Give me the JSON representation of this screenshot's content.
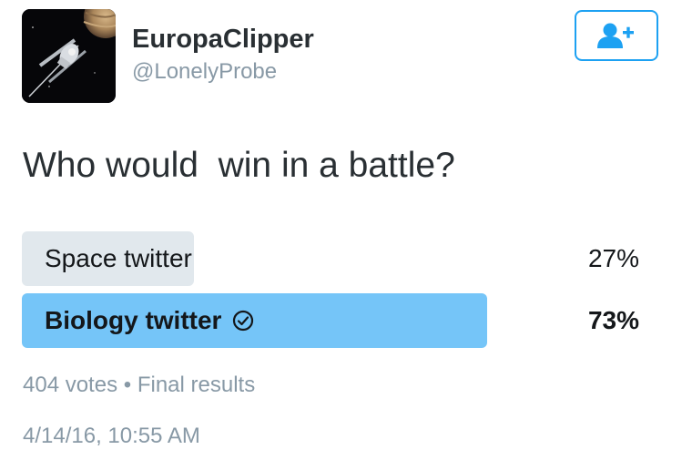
{
  "user": {
    "name": "EuropaClipper",
    "handle": "@LonelyProbe",
    "avatar_icon": "spacecraft-icon"
  },
  "follow_icon": "add-user-icon",
  "tweet": {
    "question": "Who would  win in a battle?",
    "poll": {
      "options": [
        {
          "label": "Space twitter",
          "percent": "27%",
          "value": 27,
          "winner": false
        },
        {
          "label": "Biology twitter",
          "percent": "73%",
          "value": 73,
          "winner": true
        }
      ],
      "votes": "404 votes",
      "separator": "•",
      "status": "Final results"
    },
    "timestamp": "4/14/16, 10:55 AM"
  },
  "colors": {
    "accent": "#1da1f2",
    "winner_bar": "#75c5f8",
    "loser_bar": "#e1e8ed",
    "secondary_text": "#8899a6"
  }
}
